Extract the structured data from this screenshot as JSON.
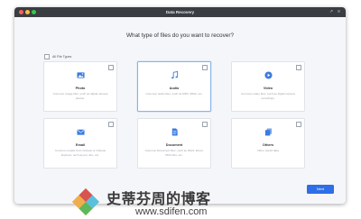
{
  "window": {
    "title": "Data Recovery"
  },
  "main": {
    "question": "What type of files do you want to recover?",
    "all_types_label": "All File Types",
    "cards": [
      {
        "name": "Photo",
        "desc": "Common image files, such as digital camera photos.",
        "icon": "photo-icon"
      },
      {
        "name": "Audio",
        "desc": "Common audio files, such as MP3, WMA, etc.",
        "icon": "music-note-icon"
      },
      {
        "name": "Video",
        "desc": "Common video files, such as digital camera recordings.",
        "icon": "play-icon"
      },
      {
        "name": "Email",
        "desc": "Common emails from Outlook or Outlook Express, such as pst, dbx, etc.",
        "icon": "envelope-icon"
      },
      {
        "name": "Document",
        "desc": "Common Document files, such as Word, Excel, PDF files, etc.",
        "icon": "document-icon"
      },
      {
        "name": "Others",
        "desc": "Other useful data",
        "icon": "files-icon"
      }
    ],
    "next_label": "Next"
  },
  "watermark": {
    "chinese": "史蒂芬周的博客",
    "url": "www.sdifen.com"
  },
  "colors": {
    "accent": "#2e6ee6",
    "icon": "#3b7be0",
    "titlebar": "#3a3d42"
  }
}
